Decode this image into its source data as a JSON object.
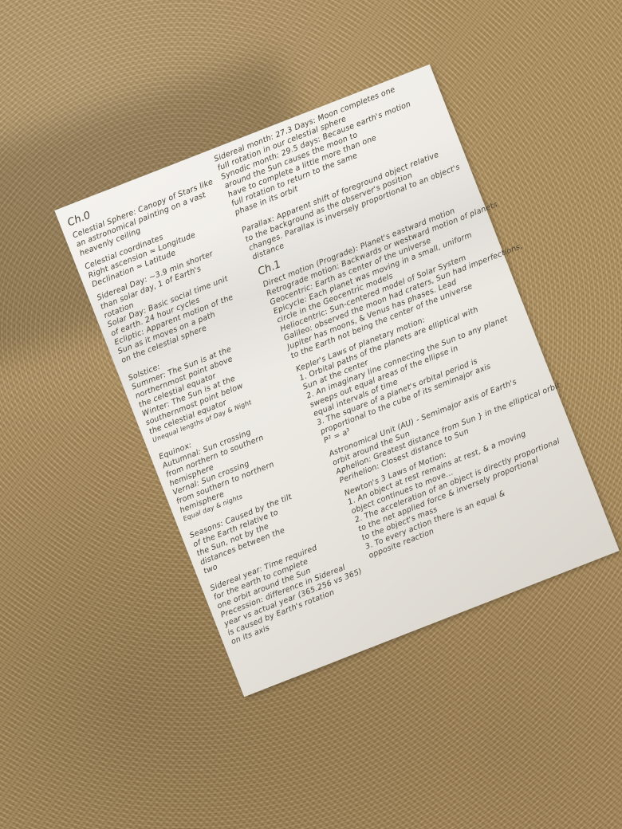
{
  "notes": {
    "left": {
      "heading": "Ch.0",
      "lines": [
        "Celestial Sphere: Canopy of Stars like",
        "an astronomical painting on a vast",
        "heavenly ceiling",
        "Celestial coordinates",
        "Right ascension ≈ Longitude",
        "Declination ≈ Latitude",
        "Sidereal Day: ~3.9 min shorter",
        "than solar day, 1 of Earth's",
        "rotation",
        "Solar Day: Basic social time unit",
        "of earth. 24 hour cycles",
        "Ecliptic: Apparent motion of the",
        "Sun as it moves on a path",
        "on the celestial sphere",
        "Solstice:",
        "Summer: The Sun is at the",
        "northernmost point above",
        "the celestial equator",
        "Winter: The Sun is at the",
        "southernmost point below",
        "the celestial equator",
        "Unequal lengths of Day & Night",
        "Equinox:",
        "Autumnal: Sun crossing",
        "from northern to southern",
        "hemisphere",
        "Vernal: Sun crossing",
        "from southern to northern",
        "hemisphere",
        "Equal day & nights",
        "Seasons: Caused by the tilt",
        "of the Earth relative to",
        "the Sun, not by the",
        "distances between the",
        "two",
        "Sidereal year: Time required",
        "for the earth to complete",
        "one orbit around the Sun",
        "Precession: difference in Sidereal",
        "year vs actual year (365.256 vs 365)",
        "is caused by Earth's rotation",
        "on its axis"
      ]
    },
    "right": {
      "lines_top": [
        "Sidereal month: 27.3 Days: Moon completes one",
        "full rotation in our celestial sphere",
        "Synodic month: 29.5 days: Because earth's motion",
        "around the Sun causes the moon to",
        "have to complete a little more than one",
        "full rotation to return to the same",
        "phase in its orbit",
        "Parallax: Apparent shift of foreground object relative",
        "to the background as the observer's position",
        "changes. Parallax is inversely proportional to an object's",
        "distance"
      ],
      "heading": "Ch.1",
      "lines_ch1": [
        "Direct motion (Prograde): Planet's eastward motion",
        "Retrograde motion: Backwards or westward motion of planets",
        "Geocentric: Earth as center of the universe",
        "Epicycle: Each planet was moving in a small, uniform",
        "circle in the Geocentric models",
        "Heliocentric: Sun-centered model of Solar System",
        "Galileo: observed the moon had craters, Sun had imperfections,",
        "Jupiter has moons, & Venus has phases. Lead",
        "to the Earth not being the center of the universe",
        "Kepler's Laws of planetary motion:",
        "1. Orbital paths of the planets are elliptical with",
        "Sun at the center",
        "2. An imaginary line connecting the Sun to any planet",
        "sweeps out equal areas of the ellipse in",
        "equal intervals of time",
        "3. The square of a planet's orbital period is",
        "proportional to the cube of its semimajor axis",
        "P² = a³",
        "Astronomical Unit (AU) - Semimajor axis of Earth's",
        "orbit around the Sun",
        "Aphelion: Greatest distance from Sun } in the elliptical orbit",
        "Perihelion: Closest distance to Sun",
        "Newton's 3 Laws of Motion:",
        "1. An object at rest remains at rest, & a moving",
        "object continues to move...",
        "2. The acceleration of an object is directly proportional",
        "to the net applied force & inversely proportional",
        "to the object's mass",
        "3. To every action there is an equal &",
        "opposite reaction"
      ]
    }
  }
}
